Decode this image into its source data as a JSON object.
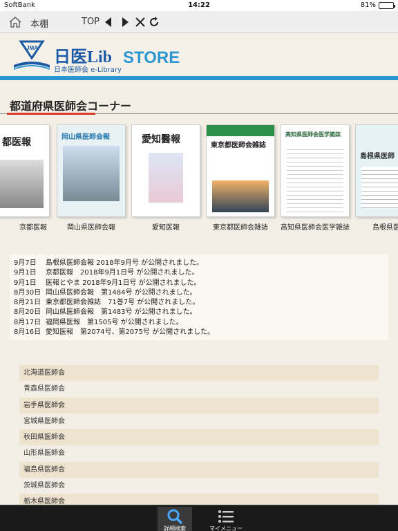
{
  "status": {
    "carrier": "SoftBank",
    "time": "14:22",
    "battery": "81%",
    "battery_level": 0.81
  },
  "toolbar": {
    "home_label": "本棚",
    "top_label": "TOP",
    "icons": [
      "home-icon",
      "back-arrow-icon",
      "forward-arrow-icon",
      "close-icon",
      "reload-icon"
    ]
  },
  "header": {
    "brand": "日医Lib",
    "brand_sub": "日本医師会 e-Library",
    "store": "STORE",
    "logo_text": "JMA"
  },
  "section": {
    "title": "都道府県医師会コーナー"
  },
  "journals": [
    {
      "name": "京都医報",
      "cover": "都医報"
    },
    {
      "name": "岡山県医師会報",
      "cover": "岡山県医師会報"
    },
    {
      "name": "愛知医報",
      "cover": "愛知醫報"
    },
    {
      "name": "東京都医師会雑誌",
      "cover": "東京都医師会雑誌"
    },
    {
      "name": "高知県医師会医学雑誌",
      "cover": "高知県医師会医学雑誌"
    },
    {
      "name": "島根県医師",
      "cover": "島根県医師"
    }
  ],
  "news": [
    {
      "date": "9月7日",
      "text": "島根県医師会報 2018年9月号 が公開されました。"
    },
    {
      "date": "9月1日",
      "text": "京都医報　2018年9月1日号 が公開されました。"
    },
    {
      "date": "9月1日",
      "text": "医報とやま 2018年9月1日号 が公開されました。"
    },
    {
      "date": "8月30日",
      "text": "岡山県医師会報　第1484号 が公開されました。"
    },
    {
      "date": "8月21日",
      "text": "東京都医師会雑誌　71巻7号 が公開されました。"
    },
    {
      "date": "8月20日",
      "text": "岡山県医師会報　第1483号 が公開されました。"
    },
    {
      "date": "8月17日",
      "text": "福岡県医報　第1505号 が公開されました。"
    },
    {
      "date": "8月16日",
      "text": "愛知医報　第2074号、第2075号 が公開されました。"
    }
  ],
  "prefectures": [
    "北海道医師会",
    "青森県医師会",
    "岩手県医師会",
    "宮城県医師会",
    "秋田県医師会",
    "山形県医師会",
    "福島県医師会",
    "茨城県医師会",
    "栃木県医師会"
  ],
  "tabs": [
    {
      "label": "詳細検索",
      "icon": "search-icon",
      "active": true
    },
    {
      "label": "マイメニュー",
      "icon": "menu-list-icon",
      "active": false
    }
  ],
  "colors": {
    "accent_blue": "#2a96d2",
    "brand_blue": "#1c5aa5",
    "underline_red": "#d83a2e",
    "list_stripe": "#eee3cf"
  }
}
